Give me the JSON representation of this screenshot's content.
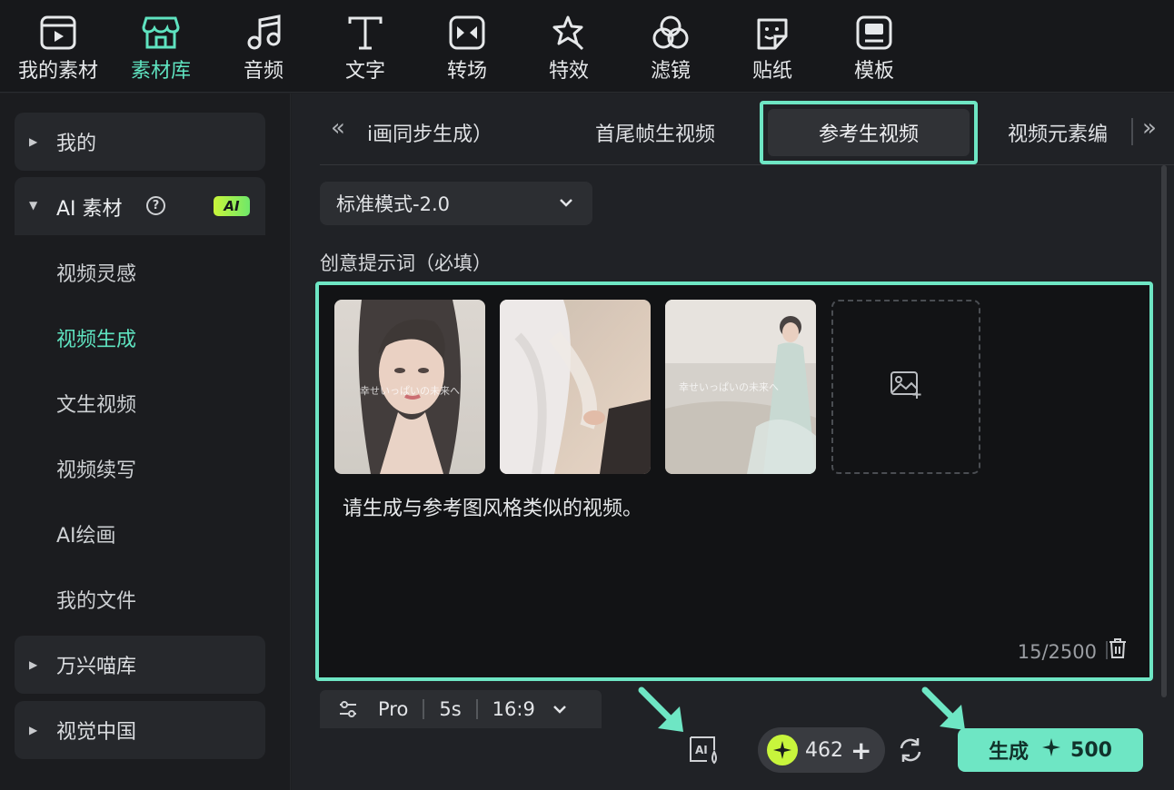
{
  "toolbar": {
    "items": [
      {
        "label": "我的素材",
        "icon": "play-box-icon"
      },
      {
        "label": "素材库",
        "icon": "store-icon"
      },
      {
        "label": "音频",
        "icon": "music-note-icon"
      },
      {
        "label": "文字",
        "icon": "text-t-icon"
      },
      {
        "label": "转场",
        "icon": "transition-icon"
      },
      {
        "label": "特效",
        "icon": "sparkle-star-icon"
      },
      {
        "label": "滤镜",
        "icon": "filter-circles-icon"
      },
      {
        "label": "贴纸",
        "icon": "sticker-icon"
      },
      {
        "label": "模板",
        "icon": "template-icon"
      }
    ],
    "active_index": 1,
    "accent": "#5fe3c0"
  },
  "sidebar": {
    "group_mine": "我的",
    "group_ai": "AI 素材",
    "ai_badge": "AI",
    "items": [
      "视频灵感",
      "视频生成",
      "文生视频",
      "视频续写",
      "AI绘画",
      "我的文件"
    ],
    "active_item": "视频生成",
    "group_wanxing": "万兴喵库",
    "group_visual": "视觉中国"
  },
  "tabs": {
    "items": [
      "画同步生成）",
      "首尾帧生视频",
      "参考生视频",
      "视频元素编辑"
    ],
    "active": "参考生视频",
    "truncated_left": "i画同步生成）",
    "truncated_right": "视频元素编"
  },
  "mode_select": {
    "value": "标准模式-2.0"
  },
  "prompt": {
    "label": "创意提示词（必填）",
    "text": "请生成与参考图风格类似的视频。",
    "count": "15/2500",
    "thumb_caption": "幸せいっぱいの未来へ"
  },
  "settings": {
    "quality": "Pro",
    "duration": "5s",
    "ratio": "16:9"
  },
  "credits": {
    "value": "462"
  },
  "generate": {
    "label": "生成",
    "cost": "500"
  },
  "colors": {
    "accent": "#6ee6c4",
    "credit_coin": "#c8f53c"
  }
}
